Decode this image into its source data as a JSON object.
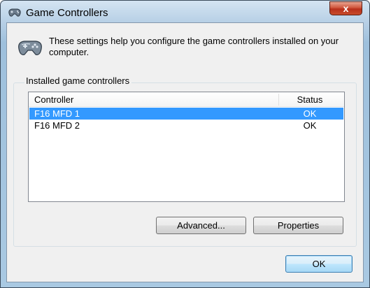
{
  "window": {
    "title": "Game Controllers",
    "close_label": "x",
    "title_icon": "gamepad-icon"
  },
  "intro": {
    "text": "These settings help you configure the game controllers installed on your computer.",
    "icon": "gamepad-icon"
  },
  "group": {
    "label": "Installed game controllers"
  },
  "list": {
    "columns": [
      "Controller",
      "Status"
    ],
    "rows": [
      {
        "name": "F16 MFD 1",
        "status": "OK",
        "selected": true
      },
      {
        "name": "F16 MFD 2",
        "status": "OK",
        "selected": false
      }
    ]
  },
  "buttons": {
    "advanced": "Advanced...",
    "properties": "Properties",
    "ok": "OK"
  },
  "colors": {
    "selection": "#3399ff",
    "close_button": "#c84c2a",
    "default_button_border": "#3c7fb1"
  }
}
